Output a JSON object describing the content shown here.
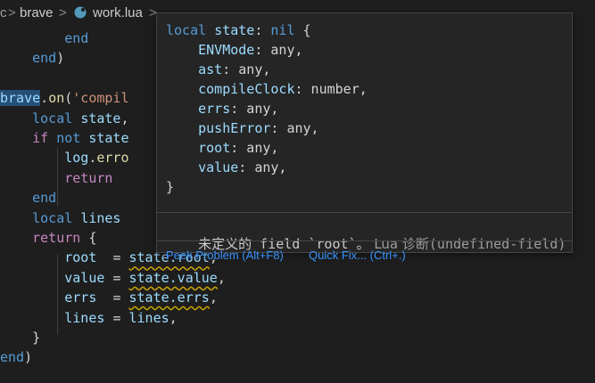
{
  "breadcrumb": {
    "cut_text": "c",
    "folder": "brave",
    "file": "work.lua",
    "sep": ">"
  },
  "code": [
    [
      {
        "t": "        "
      },
      {
        "c": "kw",
        "t": "end"
      }
    ],
    [
      {
        "t": "    "
      },
      {
        "c": "kw",
        "t": "end"
      },
      {
        "c": "punc",
        "t": ")"
      }
    ],
    [],
    [
      {
        "c": "global",
        "t": "brave"
      },
      {
        "c": "punc",
        "t": "."
      },
      {
        "c": "fn",
        "t": "on"
      },
      {
        "c": "punc",
        "t": "("
      },
      {
        "c": "str",
        "t": "'compil"
      }
    ],
    [
      {
        "t": "    "
      },
      {
        "c": "kw",
        "t": "local"
      },
      {
        "t": " "
      },
      {
        "c": "var",
        "t": "state"
      },
      {
        "c": "punc",
        "t": ","
      }
    ],
    [
      {
        "t": "    "
      },
      {
        "c": "ctl",
        "t": "if"
      },
      {
        "t": " "
      },
      {
        "c": "kw",
        "t": "not"
      },
      {
        "t": " "
      },
      {
        "c": "var",
        "t": "state"
      }
    ],
    [
      {
        "t": "        "
      },
      {
        "c": "var",
        "t": "log"
      },
      {
        "c": "punc",
        "t": "."
      },
      {
        "c": "fn",
        "t": "erro"
      }
    ],
    [
      {
        "t": "        "
      },
      {
        "c": "ctl",
        "t": "return"
      }
    ],
    [
      {
        "t": "    "
      },
      {
        "c": "kw",
        "t": "end"
      }
    ],
    [
      {
        "t": "    "
      },
      {
        "c": "kw",
        "t": "local"
      },
      {
        "t": " "
      },
      {
        "c": "var",
        "t": "lines"
      }
    ],
    [
      {
        "t": "    "
      },
      {
        "c": "ctl",
        "t": "return"
      },
      {
        "t": " "
      },
      {
        "c": "punc",
        "t": "{"
      }
    ],
    [
      {
        "t": "        "
      },
      {
        "c": "var",
        "t": "root"
      },
      {
        "t": "  "
      },
      {
        "c": "punc",
        "t": "= "
      },
      {
        "c": "var warn",
        "t": "state.root"
      },
      {
        "c": "punc",
        "t": ","
      }
    ],
    [
      {
        "t": "        "
      },
      {
        "c": "var",
        "t": "value"
      },
      {
        "t": " "
      },
      {
        "c": "punc",
        "t": "= "
      },
      {
        "c": "var warn",
        "t": "state.value"
      },
      {
        "c": "punc",
        "t": ","
      }
    ],
    [
      {
        "t": "        "
      },
      {
        "c": "var",
        "t": "errs"
      },
      {
        "t": "  "
      },
      {
        "c": "punc",
        "t": "= "
      },
      {
        "c": "var warn",
        "t": "state.errs"
      },
      {
        "c": "punc",
        "t": ","
      }
    ],
    [
      {
        "t": "        "
      },
      {
        "c": "var",
        "t": "lines"
      },
      {
        "t": " "
      },
      {
        "c": "punc",
        "t": "= "
      },
      {
        "c": "var",
        "t": "lines"
      },
      {
        "c": "punc",
        "t": ","
      }
    ],
    [
      {
        "t": "    "
      },
      {
        "c": "punc",
        "t": "}"
      }
    ],
    [
      {
        "c": "kw",
        "t": "end"
      },
      {
        "c": "punc",
        "t": ")"
      }
    ]
  ],
  "hover": {
    "signature": [
      [
        {
          "c": "kw",
          "t": "local"
        },
        {
          "t": " "
        },
        {
          "c": "var",
          "t": "state"
        },
        {
          "c": "punc",
          "t": ": "
        },
        {
          "c": "kw",
          "t": "nil"
        },
        {
          "c": "punc",
          "t": " {"
        }
      ],
      [
        {
          "t": "    "
        },
        {
          "c": "var",
          "t": "ENVMode"
        },
        {
          "c": "punc",
          "t": ": any,"
        }
      ],
      [
        {
          "t": "    "
        },
        {
          "c": "var",
          "t": "ast"
        },
        {
          "c": "punc",
          "t": ": any,"
        }
      ],
      [
        {
          "t": "    "
        },
        {
          "c": "var",
          "t": "compileClock"
        },
        {
          "c": "punc",
          "t": ": number,"
        }
      ],
      [
        {
          "t": "    "
        },
        {
          "c": "var",
          "t": "errs"
        },
        {
          "c": "punc",
          "t": ": any,"
        }
      ],
      [
        {
          "t": "    "
        },
        {
          "c": "var",
          "t": "pushError"
        },
        {
          "c": "punc",
          "t": ": any,"
        }
      ],
      [
        {
          "t": "    "
        },
        {
          "c": "var",
          "t": "root"
        },
        {
          "c": "punc",
          "t": ": any,"
        }
      ],
      [
        {
          "t": "    "
        },
        {
          "c": "var",
          "t": "value"
        },
        {
          "c": "punc",
          "t": ": any,"
        }
      ],
      [
        {
          "c": "punc",
          "t": "}"
        }
      ]
    ],
    "diagnostic_cn_1": "未定义的",
    "diagnostic_field": " field `root`",
    "diagnostic_cn_2": "。",
    "diagnostic_source": " Lua 诊断",
    "diagnostic_code": "(undefined-field)",
    "peek_label": "Peek Problem (Alt+F8)",
    "quickfix_label": "Quick Fix... (Ctrl+.)"
  },
  "colors": {
    "keyword": "#569cd6",
    "control": "#c586c0",
    "variable": "#9cdcfe",
    "function": "#dcdcaa",
    "string": "#ce9178",
    "link": "#3794ff",
    "warning_squiggle": "#cca700"
  }
}
